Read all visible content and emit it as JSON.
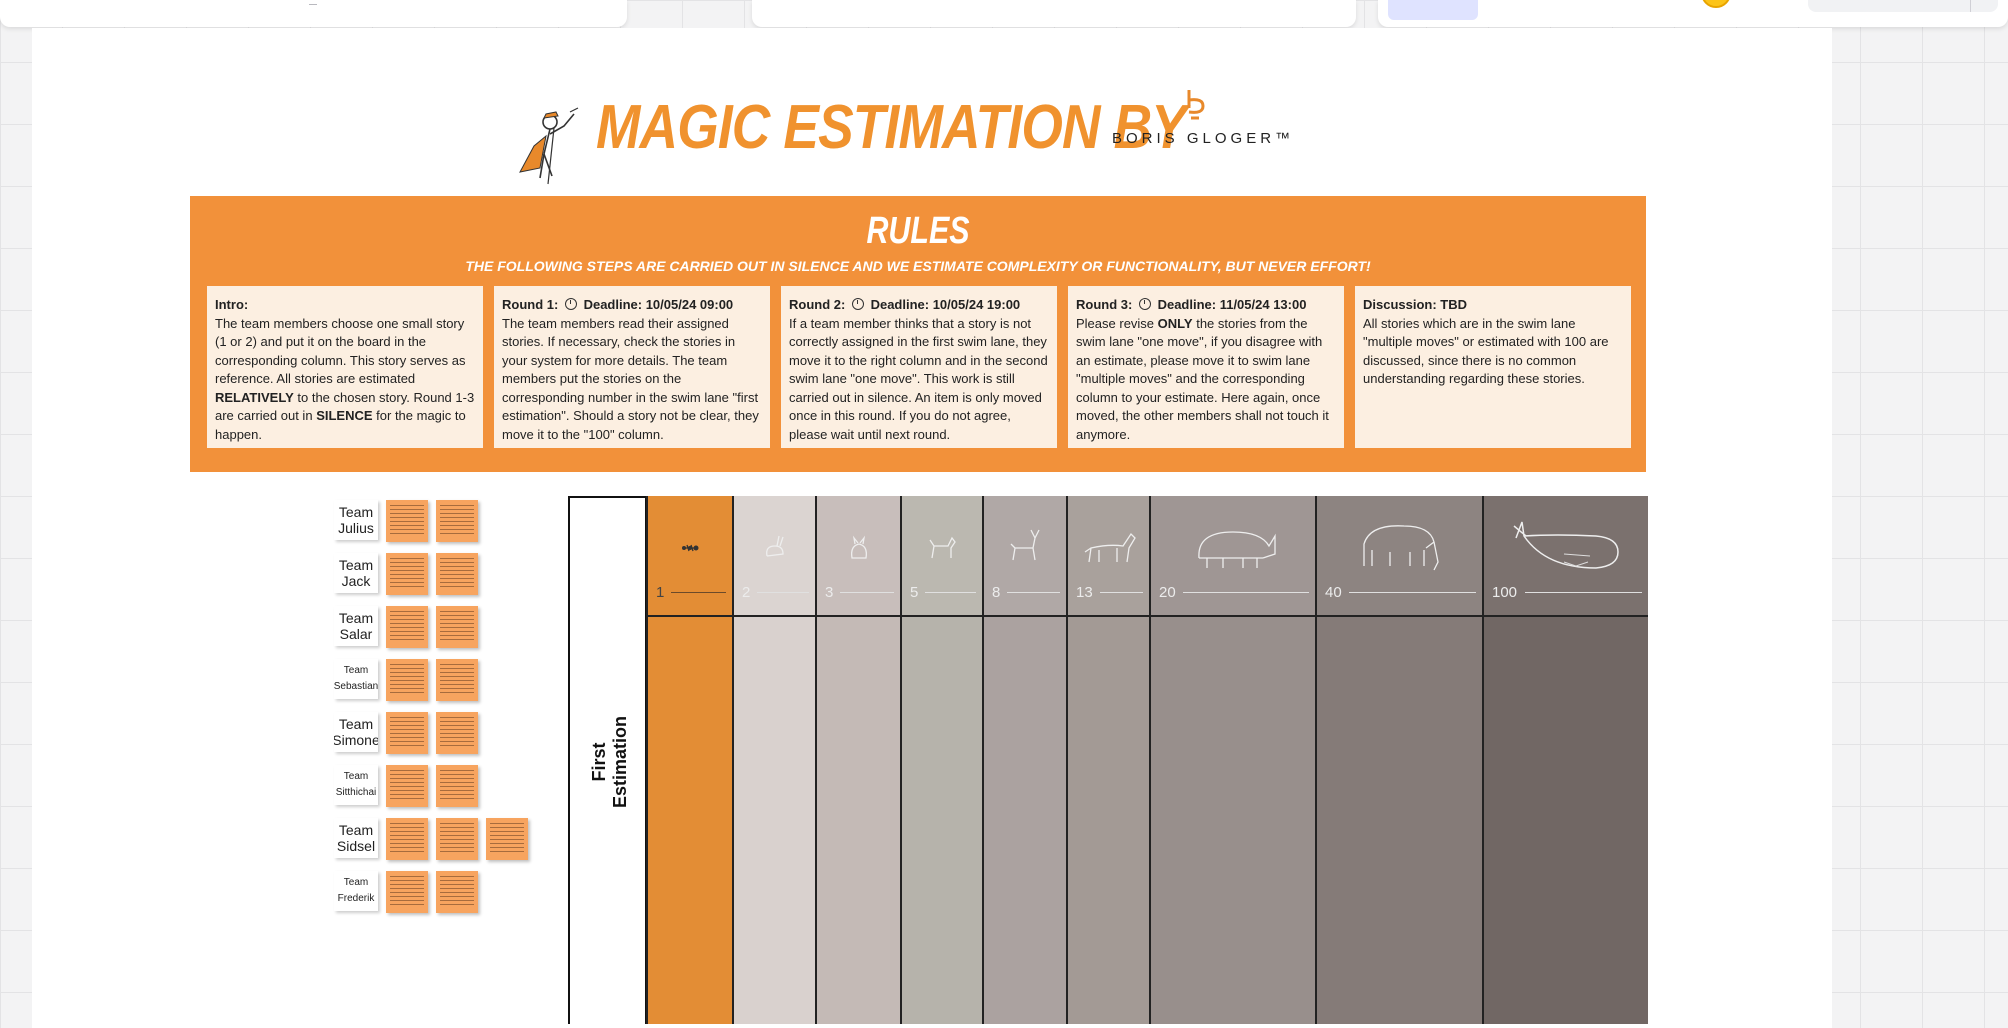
{
  "header": {
    "title": "Magic Estimation by",
    "logo_text": "BORIS GLOGER™"
  },
  "rules": {
    "title": "Rules",
    "subtitle": "The following steps are carried out in silence and we estimate complexity or functionality, but never effort!",
    "intro": {
      "label": "Intro:",
      "t1": "The team members choose one small story (1 or 2) and put it on the board in the corresponding column. This story serves as reference. All stories are estimated",
      "b1": "RELATIVELY",
      "t2": "to the chosen story. Round 1-3 are carried out in",
      "b2": "SILENCE",
      "t3": "for the magic to happen."
    },
    "round1": {
      "label": "Round 1:",
      "deadline": "Deadline: 10/05/24 09:00",
      "text": "The team members read their assigned stories. If necessary, check the stories in your system for more details. The team members put the stories on the corresponding number in the swim lane \"first estimation\". Should a story not be clear, they move it to the \"100\" column."
    },
    "round2": {
      "label": "Round 2:",
      "deadline": "Deadline: 10/05/24 19:00",
      "text": "If a team member thinks that a story is not correctly assigned in the first swim lane, they move it to the right column and in the second swim lane \"one move\". This work is still carried out in silence. An item is only moved once in this round. If you do not agree, please wait until next round."
    },
    "round3": {
      "label": "Round 3:",
      "deadline": "Deadline: 11/05/24 13:00",
      "t1": "Please revise",
      "b1": "ONLY",
      "t2": "the stories from the swim lane \"one move\", if you disagree with an estimate, please move it to swim lane \"multiple moves\" and the corresponding column to your estimate. Here again, once moved, the other members shall not touch it anymore."
    },
    "discussion": {
      "label": "Discussion: TBD",
      "text": "All stories which are in the swim lane \"multiple moves\" or estimated with 100 are discussed, since there is no common understanding regarding these stories."
    }
  },
  "teams": [
    {
      "name": "Team Julius",
      "stickies": 2
    },
    {
      "name": "Team Jack",
      "stickies": 2
    },
    {
      "name": "Team Salar",
      "stickies": 2
    },
    {
      "name": "Team Sebastian",
      "stickies": 2
    },
    {
      "name": "Team Simone",
      "stickies": 2
    },
    {
      "name": "Team Sitthichai",
      "stickies": 2
    },
    {
      "name": "Team Sidsel",
      "stickies": 3
    },
    {
      "name": "Team Frederik",
      "stickies": 2
    }
  ],
  "lane": {
    "label": "First\nEstimation"
  },
  "columns": [
    {
      "value": "1",
      "icon": "ant-icon",
      "color": "#e38d35"
    },
    {
      "value": "2",
      "icon": "rabbit-icon",
      "color": "#d9d1ce"
    },
    {
      "value": "3",
      "icon": "cat-icon",
      "color": "#c4bab6"
    },
    {
      "value": "5",
      "icon": "dog-icon",
      "color": "#b6b3ab"
    },
    {
      "value": "8",
      "icon": "deer-icon",
      "color": "#aba2a0"
    },
    {
      "value": "13",
      "icon": "horse-icon",
      "color": "#a39a95"
    },
    {
      "value": "20",
      "icon": "rhino-icon",
      "color": "#988f8c"
    },
    {
      "value": "40",
      "icon": "elephant-icon",
      "color": "#857b78"
    },
    {
      "value": "100",
      "icon": "whale-icon",
      "color": "#716764"
    }
  ]
}
